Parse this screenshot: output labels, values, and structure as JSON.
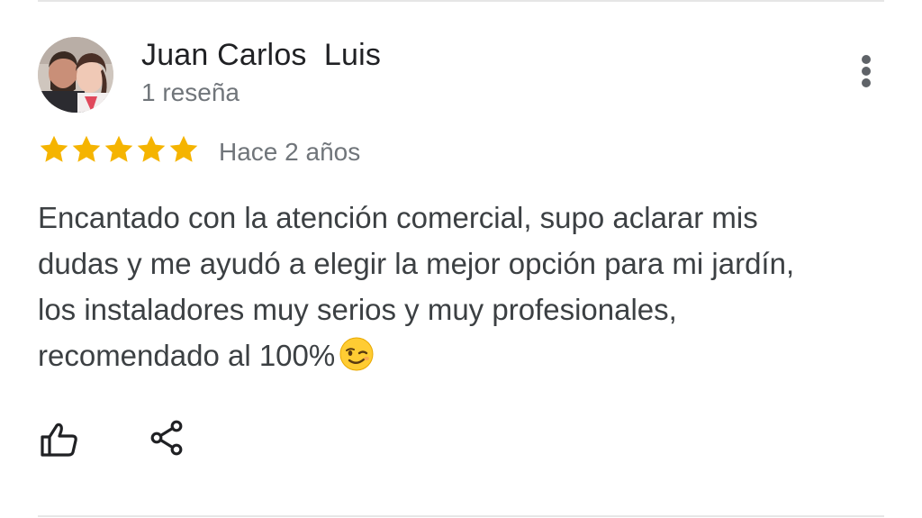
{
  "review": {
    "reviewer_name": "Juan Carlos  Luis",
    "review_count": "1 reseña",
    "rating": 5,
    "rating_max": 5,
    "date": "Hace 2 años",
    "text": "Encantado con la atención comercial, supo aclarar mis dudas y me ayudó a elegir la mejor opción para mi jardín, los instaladores muy serios y muy profesionales, recomendado al 100%",
    "emoji": "winking-face-emoji"
  },
  "actions": {
    "like_icon": "thumbs-up-icon",
    "share_icon": "share-icon",
    "more_icon": "more-vertical-icon"
  },
  "colors": {
    "star": "#F5B400",
    "name": "#202124",
    "secondary_text": "#70757a",
    "body_text": "#3c4043",
    "icon": "#202124"
  }
}
